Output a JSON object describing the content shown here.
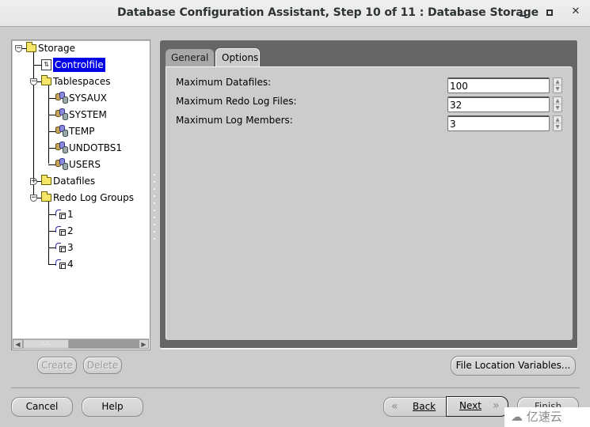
{
  "window": {
    "title": "Database Configuration Assistant, Step 10 of 11 : Database Storage",
    "controls": [
      "minimize",
      "maximize",
      "close"
    ]
  },
  "tree": {
    "root": {
      "label": "Storage",
      "expanded": true
    },
    "items": [
      {
        "label": "Controlfile",
        "type": "controlfile",
        "selected": true
      },
      {
        "label": "Tablespaces",
        "type": "folder",
        "expanded": true
      },
      {
        "label": "SYSAUX",
        "type": "tablespace"
      },
      {
        "label": "SYSTEM",
        "type": "tablespace"
      },
      {
        "label": "TEMP",
        "type": "tablespace"
      },
      {
        "label": "UNDOTBS1",
        "type": "tablespace"
      },
      {
        "label": "USERS",
        "type": "tablespace"
      },
      {
        "label": "Datafiles",
        "type": "folder",
        "expanded": false
      },
      {
        "label": "Redo Log Groups",
        "type": "folder",
        "expanded": true
      },
      {
        "label": "1",
        "type": "redo-group"
      },
      {
        "label": "2",
        "type": "redo-group"
      },
      {
        "label": "3",
        "type": "redo-group"
      },
      {
        "label": "4",
        "type": "redo-group"
      }
    ],
    "create_label": "Create",
    "delete_label": "Delete"
  },
  "tabs": [
    {
      "label": "General",
      "active": false
    },
    {
      "label": "Options",
      "active": true
    }
  ],
  "options": {
    "fields": [
      {
        "label": "Maximum Datafiles:",
        "value": "100"
      },
      {
        "label": "Maximum Redo Log Files:",
        "value": "32"
      },
      {
        "label": "Maximum Log Members:",
        "value": "3"
      }
    ]
  },
  "buttons": {
    "file_location_variables": "File Location Variables...",
    "cancel": "Cancel",
    "help": "Help",
    "back": "Back",
    "next": "Next",
    "finish": "Finish"
  },
  "icons": {
    "back": "«",
    "next": "»",
    "scroll_left": "◀",
    "scroll_right": "▶",
    "spin_up": "▲",
    "spin_down": "▼",
    "expanded": "−",
    "collapsed": "+"
  },
  "watermark": "亿速云"
}
